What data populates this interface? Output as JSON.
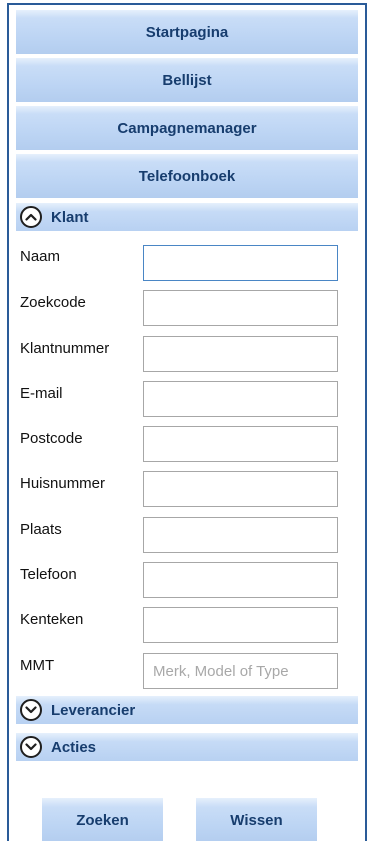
{
  "nav": {
    "items": [
      {
        "label": "Startpagina"
      },
      {
        "label": "Bellijst"
      },
      {
        "label": "Campagnemanager"
      },
      {
        "label": "Telefoonboek"
      }
    ]
  },
  "klant": {
    "title": "Klant",
    "toggle_icon": "chevron-up-icon",
    "expanded": true,
    "fields": [
      {
        "label": "Naam",
        "value": "",
        "placeholder": "",
        "focused": true
      },
      {
        "label": "Zoekcode",
        "value": "",
        "placeholder": ""
      },
      {
        "label": "Klantnummer",
        "value": "",
        "placeholder": ""
      },
      {
        "label": "E-mail",
        "value": "",
        "placeholder": ""
      },
      {
        "label": "Postcode",
        "value": "",
        "placeholder": ""
      },
      {
        "label": "Huisnummer",
        "value": "",
        "placeholder": ""
      },
      {
        "label": "Plaats",
        "value": "",
        "placeholder": ""
      },
      {
        "label": "Telefoon",
        "value": "",
        "placeholder": ""
      },
      {
        "label": "Kenteken",
        "value": "",
        "placeholder": ""
      },
      {
        "label": "MMT",
        "value": "",
        "placeholder": "Merk, Model of Type"
      }
    ]
  },
  "leverancier": {
    "title": "Leverancier",
    "toggle_icon": "chevron-down-icon",
    "expanded": false
  },
  "acties": {
    "title": "Acties",
    "toggle_icon": "chevron-down-icon",
    "expanded": false
  },
  "actions": {
    "search_label": "Zoeken",
    "clear_label": "Wissen"
  },
  "colors": {
    "border": "#2a5b98",
    "accent_text": "#173d6e",
    "button_fill": "#bdd5f4"
  }
}
